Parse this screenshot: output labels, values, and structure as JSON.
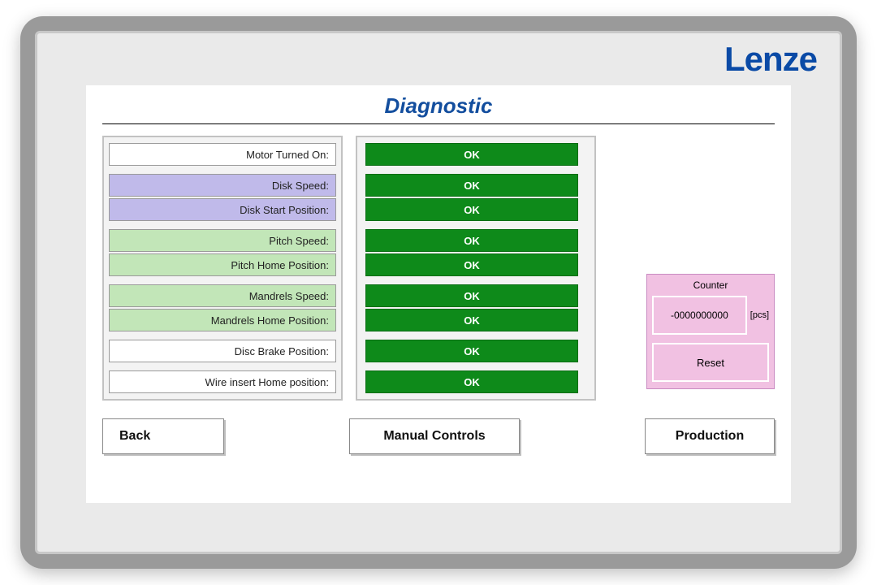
{
  "brand": "Lenze",
  "title": "Diagnostic",
  "colors": {
    "accent": "#0a4aa6",
    "ok_bg": "#0e8a1a",
    "counter_bg": "#f1c1e2"
  },
  "diagnostics": [
    {
      "label": "Motor Turned On:",
      "status": "OK",
      "group": ""
    },
    {
      "label": "Disk Speed:",
      "status": "OK",
      "group": "purple"
    },
    {
      "label": "Disk Start Position:",
      "status": "OK",
      "group": "purple"
    },
    {
      "label": "Pitch Speed:",
      "status": "OK",
      "group": "green"
    },
    {
      "label": "Pitch Home Position:",
      "status": "OK",
      "group": "green"
    },
    {
      "label": "Mandrels Speed:",
      "status": "OK",
      "group": "green"
    },
    {
      "label": "Mandrels Home Position:",
      "status": "OK",
      "group": "green"
    },
    {
      "label": "Disc Brake Position:",
      "status": "OK",
      "group": ""
    },
    {
      "label": "Wire insert Home position:",
      "status": "OK",
      "group": ""
    }
  ],
  "counter": {
    "title": "Counter",
    "value": "-0000000000",
    "unit": "[pcs]",
    "reset_label": "Reset"
  },
  "nav": {
    "back": "Back",
    "manual": "Manual Controls",
    "production": "Production"
  }
}
